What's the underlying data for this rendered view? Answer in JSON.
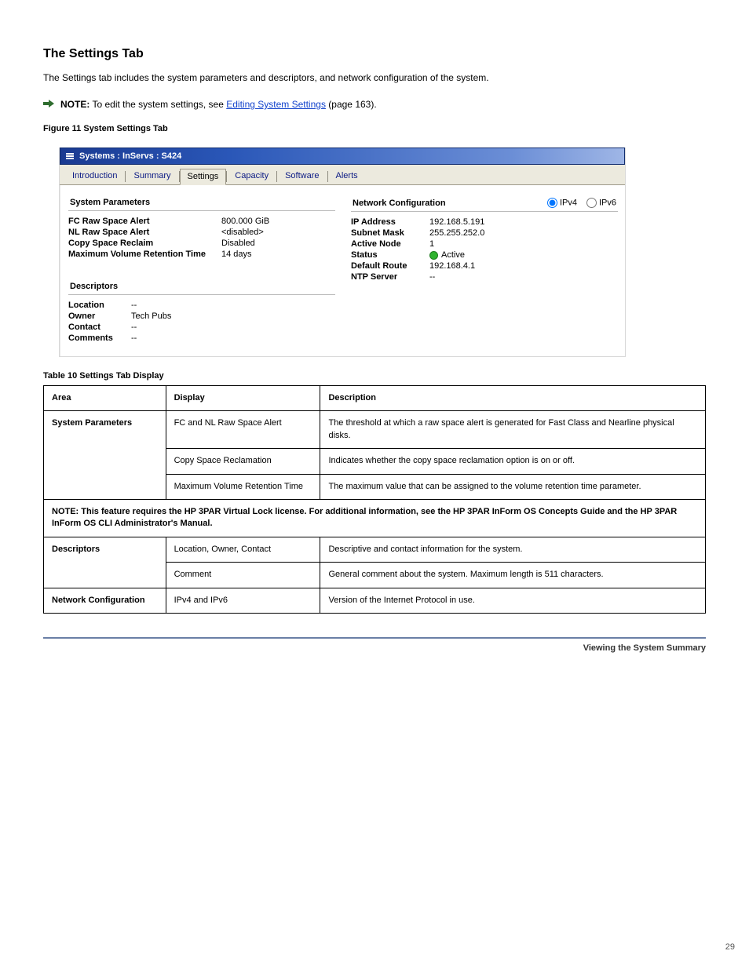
{
  "heading": "The Settings Tab",
  "intro": "The Settings tab includes the system parameters and descriptors, and network configuration of the system.",
  "note": {
    "label": "NOTE:",
    "text_pre": "To edit the system settings, see ",
    "link_text": "Editing System Settings",
    "text_post": " (page 163)."
  },
  "figure_caption": "Figure 11 System Settings Tab",
  "shot": {
    "title": "Systems : InServs : S424",
    "tabs": [
      "Introduction",
      "Summary",
      "Settings",
      "Capacity",
      "Software",
      "Alerts"
    ],
    "active_tab_index": 2,
    "sys_params_head": "System Parameters",
    "sys_params": [
      {
        "label": "FC Raw Space Alert",
        "value": "800.000 GiB"
      },
      {
        "label": "NL Raw Space Alert",
        "value": "<disabled>"
      },
      {
        "label": "Copy Space Reclaim",
        "value": "Disabled"
      },
      {
        "label": "Maximum Volume Retention Time",
        "value": "14 days"
      }
    ],
    "descriptors_head": "Descriptors",
    "descriptors": [
      {
        "label": "Location",
        "value": "--"
      },
      {
        "label": "Owner",
        "value": "Tech Pubs"
      },
      {
        "label": "Contact",
        "value": "--"
      },
      {
        "label": "Comments",
        "value": "--"
      }
    ],
    "netcfg_head": "Network Configuration",
    "radios": {
      "ipv4": "IPv4",
      "ipv6": "IPv6",
      "selected": "ipv4"
    },
    "net": [
      {
        "label": "IP Address",
        "value": "192.168.5.191"
      },
      {
        "label": "Subnet Mask",
        "value": "255.255.252.0"
      },
      {
        "label": "Active Node",
        "value": "1"
      },
      {
        "label": "Status",
        "value": "Active",
        "dot": true
      },
      {
        "label": "Default Route",
        "value": "192.168.4.1"
      },
      {
        "label": "NTP Server",
        "value": "--"
      }
    ]
  },
  "table_caption": "Table 10 Settings Tab Display",
  "table": {
    "headers": [
      "Area",
      "Display",
      "Description"
    ],
    "rows": [
      {
        "area": "System Parameters",
        "rowspan": 3,
        "display": "FC and NL Raw Space Alert",
        "desc": "The threshold at which a raw space alert is generated for Fast Class and Nearline physical disks."
      },
      {
        "display": "Copy Space Reclamation",
        "desc": "Indicates whether the copy space reclamation option is on or off."
      },
      {
        "display": "Maximum Volume Retention Time",
        "desc": "The maximum value that can be assigned to the volume retention time parameter."
      },
      {
        "sub": true,
        "text": "NOTE: This feature requires the HP 3PAR Virtual Lock license. For additional information, see the HP 3PAR InForm OS Concepts Guide and the HP 3PAR InForm OS CLI Administrator's Manual."
      },
      {
        "area": "Descriptors",
        "rowspan": 2,
        "display": "Location, Owner, Contact",
        "desc": "Descriptive and contact information for the system."
      },
      {
        "display": "Comment",
        "desc": "General comment about the system. Maximum length is 511 characters."
      },
      {
        "area": "Network Configuration",
        "rowspan": 1,
        "display": "IPv4 and IPv6",
        "desc": "Version of the Internet Protocol in use."
      }
    ]
  },
  "footer": {
    "text": "Viewing the System Summary",
    "page": "29"
  }
}
